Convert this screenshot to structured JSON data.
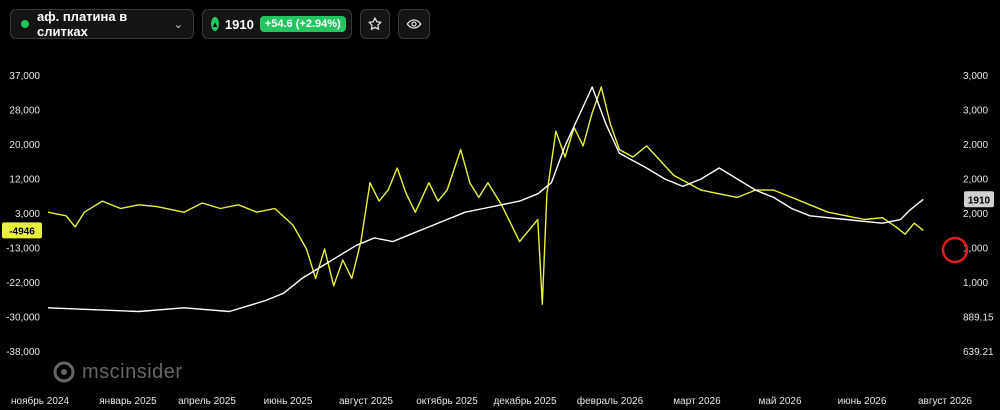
{
  "header": {
    "instrument": "аф. платина в слитках",
    "price": "1910",
    "change": "+54.6 (+2.94%)"
  },
  "logo": "mscinsider",
  "chart_data": {
    "type": "line",
    "left_axis": {
      "ticks": [
        "37,000",
        "28,000",
        "20,000",
        "12,000",
        "3,000",
        "-13,000",
        "-22,000",
        "-30,000",
        "-38,000"
      ],
      "current": "-4946"
    },
    "right_axis": {
      "ticks": [
        "3,000",
        "3,000",
        "2,000",
        "2,000",
        "2,000",
        "1,000",
        "1,000",
        "889.15",
        "639.21"
      ],
      "current": "1910"
    },
    "x_ticks": [
      "ноябрь 2024",
      "январь 2025",
      "апрель 2025",
      "июнь 2025",
      "август 2025",
      "октябрь 2025",
      "декабрь 2025",
      "февраль 2026",
      "март 2026",
      "май 2026",
      "июнь 2026",
      "август 2026"
    ],
    "series": [
      {
        "color": "#e8f23a",
        "axis": "left",
        "values": [
          [
            0,
            0
          ],
          [
            0.02,
            -1000
          ],
          [
            0.03,
            -4000
          ],
          [
            0.04,
            0
          ],
          [
            0.06,
            3000
          ],
          [
            0.08,
            1000
          ],
          [
            0.1,
            2000
          ],
          [
            0.12,
            1500
          ],
          [
            0.15,
            0
          ],
          [
            0.17,
            2500
          ],
          [
            0.19,
            1000
          ],
          [
            0.21,
            2000
          ],
          [
            0.23,
            0
          ],
          [
            0.25,
            1000
          ],
          [
            0.27,
            -3500
          ],
          [
            0.285,
            -10000
          ],
          [
            0.295,
            -18000
          ],
          [
            0.305,
            -10000
          ],
          [
            0.315,
            -20000
          ],
          [
            0.325,
            -13000
          ],
          [
            0.335,
            -18000
          ],
          [
            0.345,
            -8000
          ],
          [
            0.355,
            8000
          ],
          [
            0.365,
            3000
          ],
          [
            0.375,
            6000
          ],
          [
            0.385,
            12000
          ],
          [
            0.395,
            5000
          ],
          [
            0.405,
            0
          ],
          [
            0.42,
            8000
          ],
          [
            0.43,
            3000
          ],
          [
            0.44,
            6000
          ],
          [
            0.455,
            17000
          ],
          [
            0.465,
            8000
          ],
          [
            0.475,
            4000
          ],
          [
            0.485,
            8000
          ],
          [
            0.5,
            2000
          ],
          [
            0.51,
            -3000
          ],
          [
            0.52,
            -8000
          ],
          [
            0.53,
            -5000
          ],
          [
            0.54,
            -2000
          ],
          [
            0.545,
            -25000
          ],
          [
            0.55,
            5000
          ],
          [
            0.56,
            22000
          ],
          [
            0.57,
            15000
          ],
          [
            0.58,
            23000
          ],
          [
            0.59,
            18000
          ],
          [
            0.6,
            27000
          ],
          [
            0.61,
            34000
          ],
          [
            0.62,
            24000
          ],
          [
            0.63,
            17000
          ],
          [
            0.645,
            15000
          ],
          [
            0.66,
            18000
          ],
          [
            0.675,
            14000
          ],
          [
            0.69,
            10000
          ],
          [
            0.705,
            8000
          ],
          [
            0.72,
            6000
          ],
          [
            0.74,
            5000
          ],
          [
            0.76,
            4000
          ],
          [
            0.78,
            6000
          ],
          [
            0.8,
            6000
          ],
          [
            0.82,
            4000
          ],
          [
            0.84,
            2000
          ],
          [
            0.86,
            0
          ],
          [
            0.88,
            -1000
          ],
          [
            0.9,
            -2000
          ],
          [
            0.92,
            -1500
          ],
          [
            0.935,
            -4000
          ],
          [
            0.945,
            -6000
          ],
          [
            0.955,
            -3000
          ],
          [
            0.965,
            -4946
          ]
        ]
      },
      {
        "color": "#ffffff",
        "axis": "right",
        "values": [
          [
            0,
            -26000
          ],
          [
            0.05,
            -26500
          ],
          [
            0.1,
            -27000
          ],
          [
            0.15,
            -26000
          ],
          [
            0.2,
            -27000
          ],
          [
            0.24,
            -24000
          ],
          [
            0.26,
            -22000
          ],
          [
            0.28,
            -18000
          ],
          [
            0.3,
            -15000
          ],
          [
            0.32,
            -12000
          ],
          [
            0.34,
            -9000
          ],
          [
            0.36,
            -7000
          ],
          [
            0.38,
            -8000
          ],
          [
            0.4,
            -6000
          ],
          [
            0.42,
            -4000
          ],
          [
            0.44,
            -2000
          ],
          [
            0.46,
            0
          ],
          [
            0.48,
            1000
          ],
          [
            0.5,
            2000
          ],
          [
            0.52,
            3000
          ],
          [
            0.54,
            5000
          ],
          [
            0.555,
            8000
          ],
          [
            0.57,
            18000
          ],
          [
            0.585,
            26000
          ],
          [
            0.6,
            34000
          ],
          [
            0.615,
            24000
          ],
          [
            0.63,
            16000
          ],
          [
            0.645,
            14000
          ],
          [
            0.66,
            12000
          ],
          [
            0.68,
            9000
          ],
          [
            0.7,
            7000
          ],
          [
            0.72,
            9000
          ],
          [
            0.74,
            12000
          ],
          [
            0.76,
            9000
          ],
          [
            0.78,
            6000
          ],
          [
            0.8,
            4000
          ],
          [
            0.82,
            1000
          ],
          [
            0.84,
            -1000
          ],
          [
            0.86,
            -1500
          ],
          [
            0.88,
            -2000
          ],
          [
            0.9,
            -2500
          ],
          [
            0.92,
            -3000
          ],
          [
            0.94,
            -2000
          ],
          [
            0.95,
            500
          ],
          [
            0.965,
            3500
          ]
        ]
      }
    ]
  }
}
